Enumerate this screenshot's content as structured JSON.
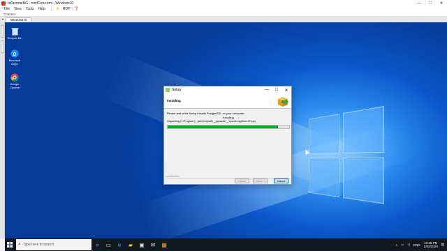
{
  "window": {
    "title": "mRemoteNG - confCons.xml - Windows10",
    "controls": [
      "—",
      "□",
      "✕"
    ]
  },
  "menu": {
    "items": [
      "File",
      "View",
      "Tools",
      "Help"
    ],
    "protocol": "RDP"
  },
  "connect": {
    "label": "Connect"
  },
  "tabs": {
    "active": "Windows10"
  },
  "desktop": {
    "icons": [
      {
        "label": "Recycle Bin",
        "icon": "recycle-bin-icon"
      },
      {
        "label": "Microsoft Edge",
        "icon": "edge-icon"
      },
      {
        "label": "Google Chrome",
        "icon": "chrome-icon"
      }
    ]
  },
  "setup": {
    "title": "Setup",
    "heading": "Installing",
    "message": "Please wait while Setup installs PostgreSQL on your computer.",
    "status": "Installing",
    "detail": "Unpacking C:\\Program [...]alchemy\\util\\__pycache__\\queue.cpython-37.pyc",
    "progress_percent": 91,
    "brand": "InstallBuilder",
    "buttons": {
      "back": "< Back",
      "next": "Next >",
      "cancel": "Cancel"
    }
  },
  "taskbar": {
    "search_placeholder": "Type here to search",
    "language": "ENG",
    "time": "10:48 PM",
    "date": "2/02/2020"
  },
  "colors": {
    "progress": "#06b025",
    "taskbar": "#101820",
    "desktop": "#0a56c8"
  }
}
